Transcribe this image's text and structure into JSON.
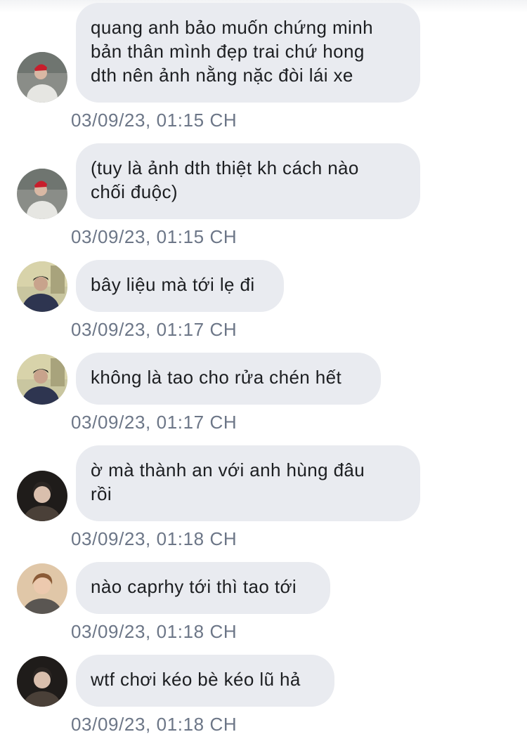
{
  "messages": [
    {
      "sender_avatar": "avatar-red-hat",
      "lines": [
        "quang anh bảo muốn chứng minh",
        "bản thân mình đẹp trai chứ hong",
        "dth nên ảnh nằng nặc đòi lái xe"
      ],
      "timestamp": "03/09/23, 01:15 CH"
    },
    {
      "sender_avatar": "avatar-red-hat",
      "lines": [
        "(tuy là ảnh dth thiệt kh cách nào",
        "chối đuộc)"
      ],
      "timestamp": "03/09/23, 01:15 CH"
    },
    {
      "sender_avatar": "avatar-green-room",
      "lines": [
        "bây liệu mà tới lẹ đi"
      ],
      "timestamp": "03/09/23, 01:17 CH"
    },
    {
      "sender_avatar": "avatar-green-room",
      "lines": [
        "không là tao cho rửa chén hết"
      ],
      "timestamp": "03/09/23, 01:17 CH"
    },
    {
      "sender_avatar": "avatar-dark-portrait",
      "lines": [
        "ờ mà thành an với anh hùng đâu",
        "rồi"
      ],
      "timestamp": "03/09/23, 01:18 CH"
    },
    {
      "sender_avatar": "avatar-warm-portrait",
      "lines": [
        "nào caprhy tới thì tao tới"
      ],
      "timestamp": "03/09/23, 01:18 CH"
    },
    {
      "sender_avatar": "avatar-dark-portrait",
      "lines": [
        "wtf chơi kéo bè kéo lũ hả"
      ],
      "timestamp": "03/09/23, 01:18 CH"
    }
  ],
  "colors": {
    "bubble_bg": "#e9ebf0",
    "bubble_text": "#1c1e21",
    "timestamp_text": "#6c7687",
    "background": "#ffffff"
  }
}
